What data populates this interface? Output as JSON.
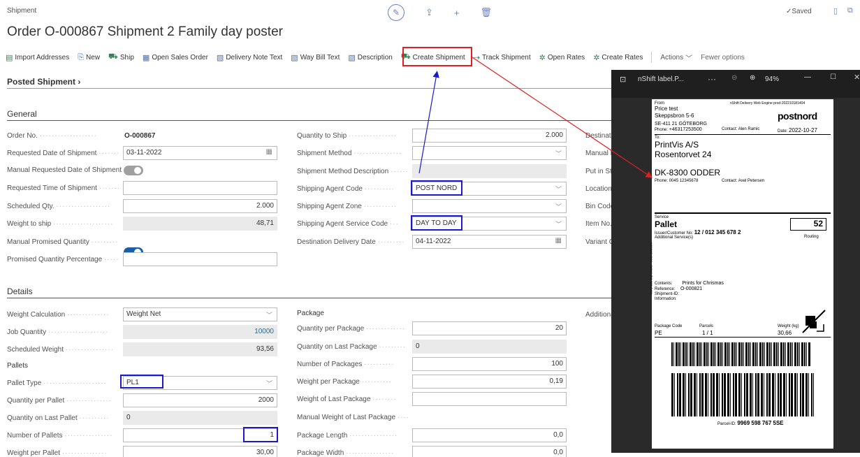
{
  "breadcrumb": "Shipment",
  "page_title": "Order O-000867 Shipment 2 Family day poster",
  "saved_label": "Saved",
  "actions": [
    {
      "label": "Import Addresses",
      "icon": "import-icon"
    },
    {
      "label": "New",
      "icon": "new-icon"
    },
    {
      "label": "Ship",
      "icon": "ship-icon"
    },
    {
      "label": "Open Sales Order",
      "icon": "document-icon"
    },
    {
      "label": "Delivery Note Text",
      "icon": "text-icon"
    },
    {
      "label": "Way Bill Text",
      "icon": "text-icon"
    },
    {
      "label": "Description",
      "icon": "text-icon"
    },
    {
      "label": "Create Shipment",
      "icon": "create-shipment-icon"
    },
    {
      "label": "Track Shipment",
      "icon": "track-icon"
    },
    {
      "label": "Open Rates",
      "icon": "rates-icon"
    },
    {
      "label": "Create Rates",
      "icon": "rates-icon"
    },
    {
      "label": "Actions",
      "icon": "chevron-down-icon"
    },
    {
      "label": "Fewer options",
      "icon": ""
    }
  ],
  "sections": {
    "posted": "Posted Shipment",
    "general": "General",
    "details": "Details"
  },
  "general": {
    "order_no": {
      "label": "Order No.",
      "value": "O-000867"
    },
    "req_date": {
      "label": "Requested Date of Shipment",
      "value": "03-11-2022"
    },
    "manual_req_date": {
      "label": "Manual Requested Date of Shipment"
    },
    "req_time": {
      "label": "Requested Time of Shipment",
      "value": ""
    },
    "sched_qty": {
      "label": "Scheduled Qty.",
      "value": "2.000"
    },
    "weight_ship": {
      "label": "Weight to ship",
      "value": "48,71"
    },
    "manual_promised": {
      "label": "Manual Promised Quantity"
    },
    "promised_pct": {
      "label": "Promised Quantity Percentage",
      "value": ""
    },
    "qty_ship": {
      "label": "Quantity to Ship",
      "value": "2.000"
    },
    "ship_method": {
      "label": "Shipment Method",
      "value": ""
    },
    "ship_method_desc": {
      "label": "Shipment Method Description",
      "value": ""
    },
    "agent_code": {
      "label": "Shipping Agent Code",
      "value": "POST NORD"
    },
    "agent_zone": {
      "label": "Shipping Agent Zone",
      "value": ""
    },
    "agent_service": {
      "label": "Shipping Agent Service Code",
      "value": "DAY TO DAY"
    },
    "dest_delivery": {
      "label": "Destination Delivery Date",
      "value": "04-11-2022"
    },
    "col3": [
      "Destinati",
      "Manual D",
      "Put in Sto",
      "Location",
      "Bin Code",
      "Item No.",
      "Variant C"
    ]
  },
  "details": {
    "weight_calc": {
      "label": "Weight Calculation",
      "value": "Weight Net"
    },
    "job_qty": {
      "label": "Job Quantity",
      "value": "10000"
    },
    "sched_weight": {
      "label": "Scheduled Weight",
      "value": "93,56"
    },
    "pallets_heading": "Pallets",
    "pallet_type": {
      "label": "Pallet Type",
      "value": "PL1"
    },
    "qty_per_pallet": {
      "label": "Quantity per Pallet",
      "value": "2000"
    },
    "qty_last_pallet": {
      "label": "Quantity on Last Pallet",
      "value": "0"
    },
    "num_pallets": {
      "label": "Number of Pallets",
      "value": "1"
    },
    "weight_pallet": {
      "label": "Weight per Pallet",
      "value": "30,00"
    },
    "package_heading": "Package",
    "qty_per_package": {
      "label": "Quantity per Package",
      "value": "20"
    },
    "qty_last_package": {
      "label": "Quantity on Last Package",
      "value": "0"
    },
    "num_packages": {
      "label": "Number of Packages",
      "value": "100"
    },
    "weight_package": {
      "label": "Weight per Package",
      "value": "0,19"
    },
    "weight_last_package": {
      "label": "Weight of Last Package",
      "value": ""
    },
    "manual_weight_last": {
      "label": "Manual Weight of Last Package"
    },
    "package_length": {
      "label": "Package Length",
      "value": "0,0"
    },
    "package_width": {
      "label": "Package Width",
      "value": "0,0"
    },
    "col3_addl": "Additiona"
  },
  "preview": {
    "title": "nShift label.P...",
    "more": "···",
    "zoom": "94%",
    "label": {
      "from_lbl": "From",
      "engine": "nShift Delivery Web Engine prod-202210181404",
      "from_name": "Price test",
      "from_addr": "Skeppsbron 5-6",
      "brand": "postnord",
      "from_city": "SE-411 21 GÖTEBORG",
      "phone_lbl": "Phone:",
      "from_phone": "+46317253500",
      "contact_lbl": "Contact:",
      "from_contact": "Alen Ramic",
      "date_lbl": "Date:",
      "date": "2022-10-27",
      "to_lbl": "To:",
      "to_name": "PrintVis A/S",
      "to_addr": "Rosentorvet 24",
      "to_city": "DK-8300 ODDER",
      "to_phone": "0045 12345678",
      "to_contact": "Axel Petersen",
      "service_lbl": "Service",
      "service": "Pallet",
      "service_code": "52",
      "issuer_lbl": "Issuer/Customer No:",
      "issuer": "12 / 012 345 678 2",
      "addl_lbl": "Additional Service(s)",
      "routing_lbl": "Routing",
      "side_text": "Worry less, ship smarter - www.nshift.com",
      "contents_lbl": "Contents:",
      "contents": "Prints for Chrismas",
      "reference_lbl": "Reference:",
      "reference": "O-000821",
      "shipment_id_lbl": "Shipment-ID:",
      "information_lbl": "Information:",
      "package_code_lbl": "Package Code",
      "package_code": "PE",
      "parcels_lbl": "Parcels",
      "parcels": "1 / 1",
      "weight_lbl": "Weight (kg)",
      "weight": "30,66",
      "parcel_id_lbl": "Parcel-ID:",
      "parcel_id": "9969 598 767 5SE"
    }
  },
  "colors": {
    "accent": "#1a5fa5",
    "highlight_red": "#e02020",
    "highlight_blue": "#1a1acc",
    "icon_green": "#3a7d5a"
  }
}
